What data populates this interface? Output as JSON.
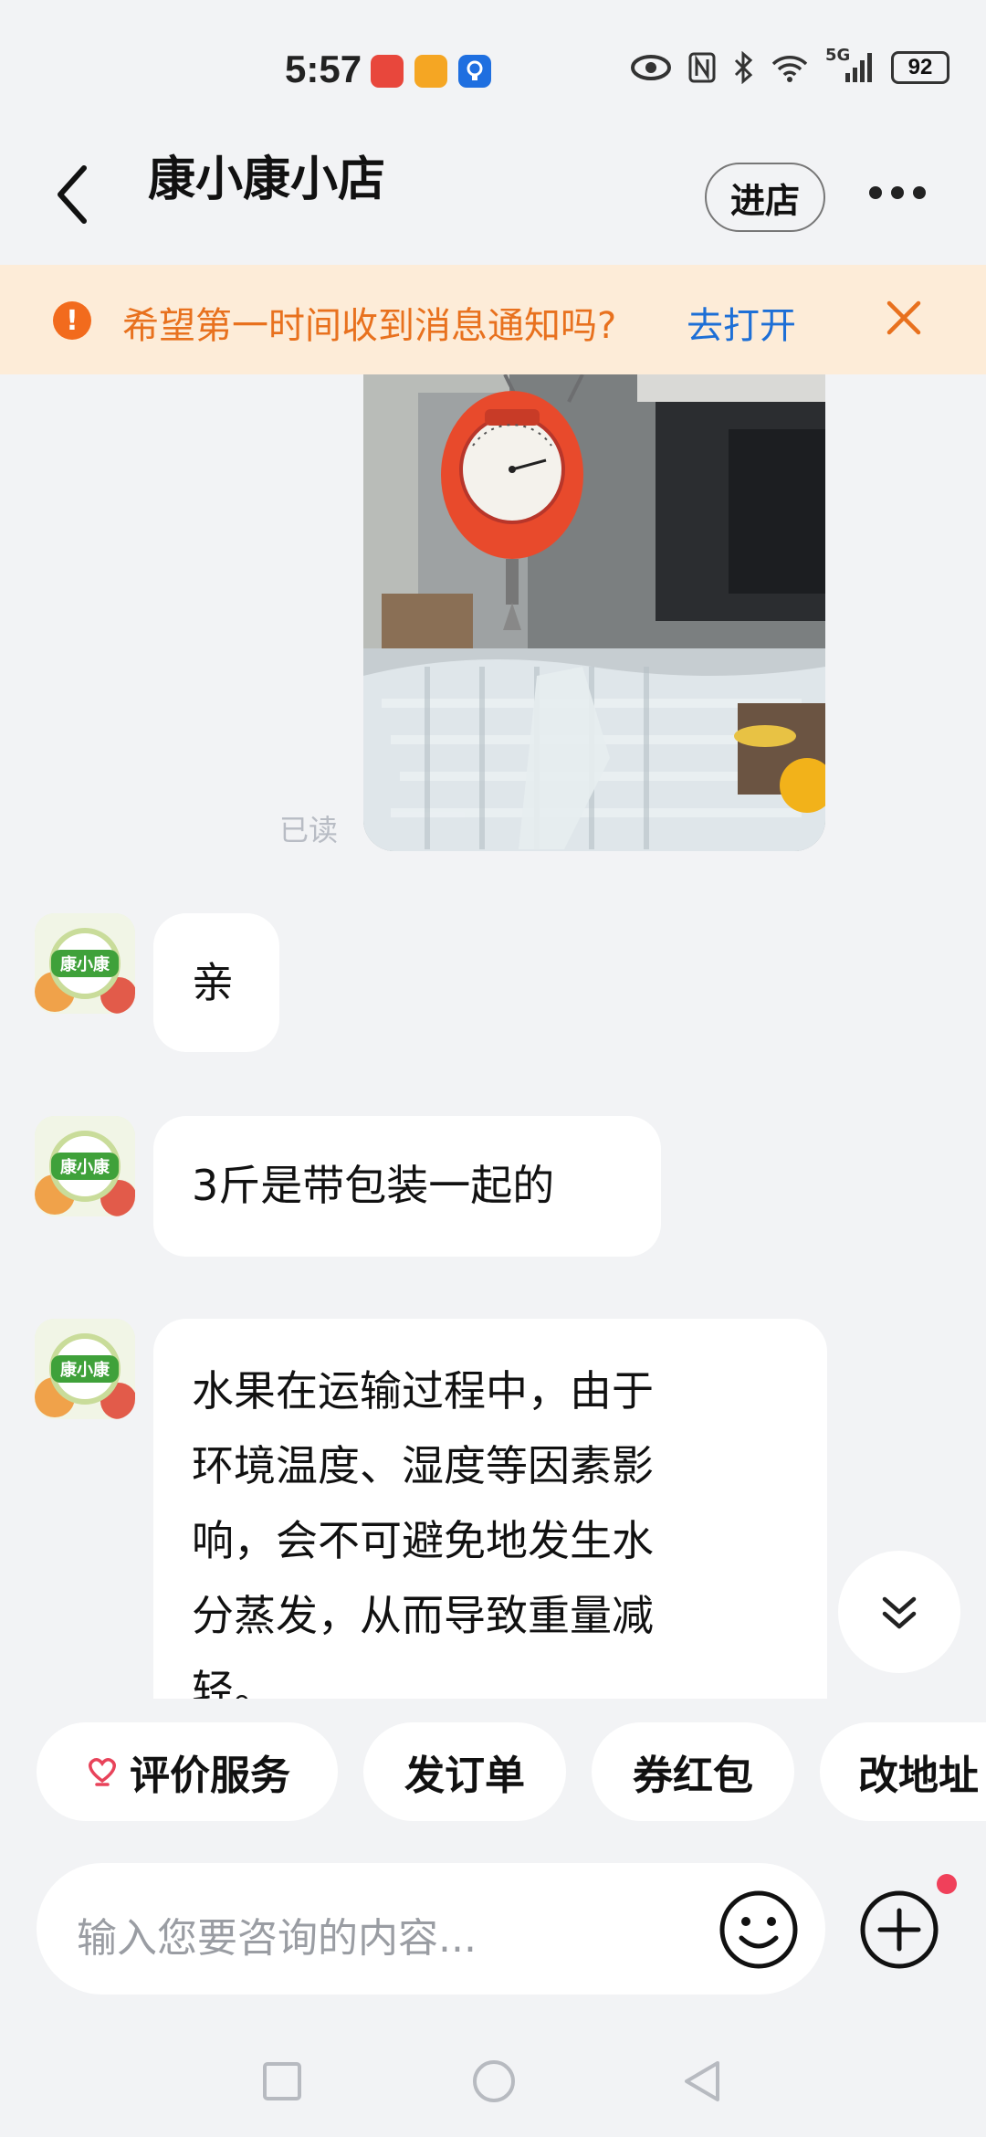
{
  "status_bar": {
    "time": "5:57",
    "battery": "92",
    "network": "5G"
  },
  "header": {
    "title": "康小康小店",
    "enter_label": "进店"
  },
  "notice": {
    "text": "希望第一时间收到消息通知吗?",
    "link": "去打开"
  },
  "chat": {
    "read_status": "已读",
    "avatar_text": "康小康",
    "messages": [
      {
        "text": "亲"
      },
      {
        "text": "3斤是带包装一起的"
      },
      {
        "lines": [
          "水果在运输过程中，由于",
          "环境温度、湿度等因素影",
          "响，会不可避免地发生水",
          "分蒸发，从而导致重量减",
          "轻。"
        ]
      }
    ]
  },
  "quick_actions": [
    "评价服务",
    "发订单",
    "券红包",
    "改地址"
  ],
  "input": {
    "placeholder": "输入您要咨询的内容..."
  },
  "colors": {
    "notice_bg": "#fdecd8",
    "notice_text": "#e8711e",
    "link": "#1d6fd6",
    "badge": "#f0405a"
  }
}
